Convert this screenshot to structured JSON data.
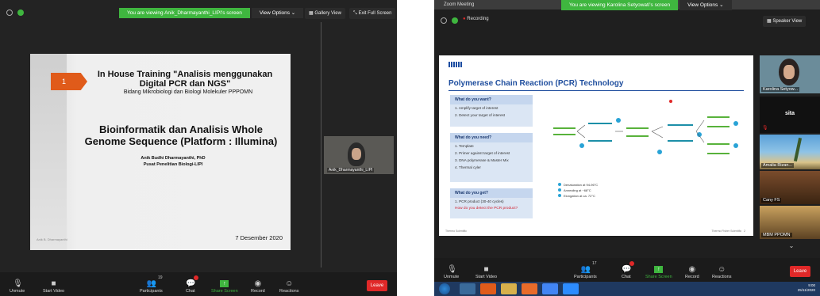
{
  "left": {
    "banner_text": "You are viewing Anik_Dharmayanthi_LIPI's screen",
    "view_options": "View Options ⌄",
    "gallery_view": "Gallery View",
    "exit_full_screen": "Exit Full Screen",
    "slide": {
      "number": "1",
      "title": "In House Training \"Analisis menggunakan Digital PCR dan NGS\"",
      "subtitle": "Bidang Mikrobiologi dan Biologi Molekuler PPPOMN",
      "main_title": "Bioinformatik dan Analisis Whole Genome Sequence (Platform : Illumina)",
      "author": "Anik Budhi Dharmayanthi, PhD",
      "institution": "Pusat Penelitian Biologi-LIPI",
      "date": "7 Desember 2020",
      "footer_small": "Anik B. Dharmayanthi"
    },
    "participant_name": "Anik_Dharmayanthi_LIPI",
    "toolbar": {
      "unmute": "Unmute",
      "start_video": "Start Video",
      "participants": "Participants",
      "participants_count": "19",
      "chat": "Chat",
      "share_screen": "Share Screen",
      "record": "Record",
      "reactions": "Reactions",
      "leave": "Leave"
    }
  },
  "right": {
    "window_title": "Zoom Meeting",
    "banner_text": "You are viewing Karolina Setyowati's screen",
    "view_options": "View Options ⌄",
    "recording": "Recording",
    "speaker_view": "Speaker View",
    "slide": {
      "title": "Polymerase Chain Reaction (PCR) Technology",
      "box1_header": "What do you want?",
      "box1_items": [
        "1.   Amplify target of interest",
        "2.   Detect your target of interest"
      ],
      "box2_header": "What do you need?",
      "box2_items": [
        "1.   Template",
        "2.   Primer against target of interest",
        "3.   DNA polymerase & Master Mix",
        "4.   Thermal cyler"
      ],
      "box3_header": "What do you get?",
      "box3_items": [
        "1.   PCR product (30-40 cycles)"
      ],
      "box3_question": "How do you detect the PCR product?",
      "legend": [
        "Denaturation at 94-96°C",
        "Annealing at ~68°C",
        "Elongation at ca. 72°C"
      ],
      "footer_left": "Thermo Scientific",
      "footer_right": "Thermo Fisher Scientific",
      "page": "2"
    },
    "side_panel": {
      "p1_name": "Karolina Setyow...",
      "p2_name": "sita",
      "p3_name": "Amalia Rizan...",
      "p4_name": "Cany FS",
      "p5_name": "MBM PPOMN"
    },
    "toolbar": {
      "unmute": "Unmute",
      "start_video": "Start Video",
      "participants": "Participants",
      "participants_count": "17",
      "chat": "Chat",
      "share_screen": "Share Screen",
      "record": "Record",
      "reactions": "Reactions",
      "leave": "Leave"
    },
    "clock_time": "9:00",
    "clock_date": "25/11/2020"
  },
  "colors": {
    "banner_green": "#3fb63f",
    "leave_red": "#e02828",
    "slide_title_blue": "#1f4e9e",
    "slide_arrow_orange": "#e05b1a",
    "taskbar_blue": "#1f3960"
  }
}
